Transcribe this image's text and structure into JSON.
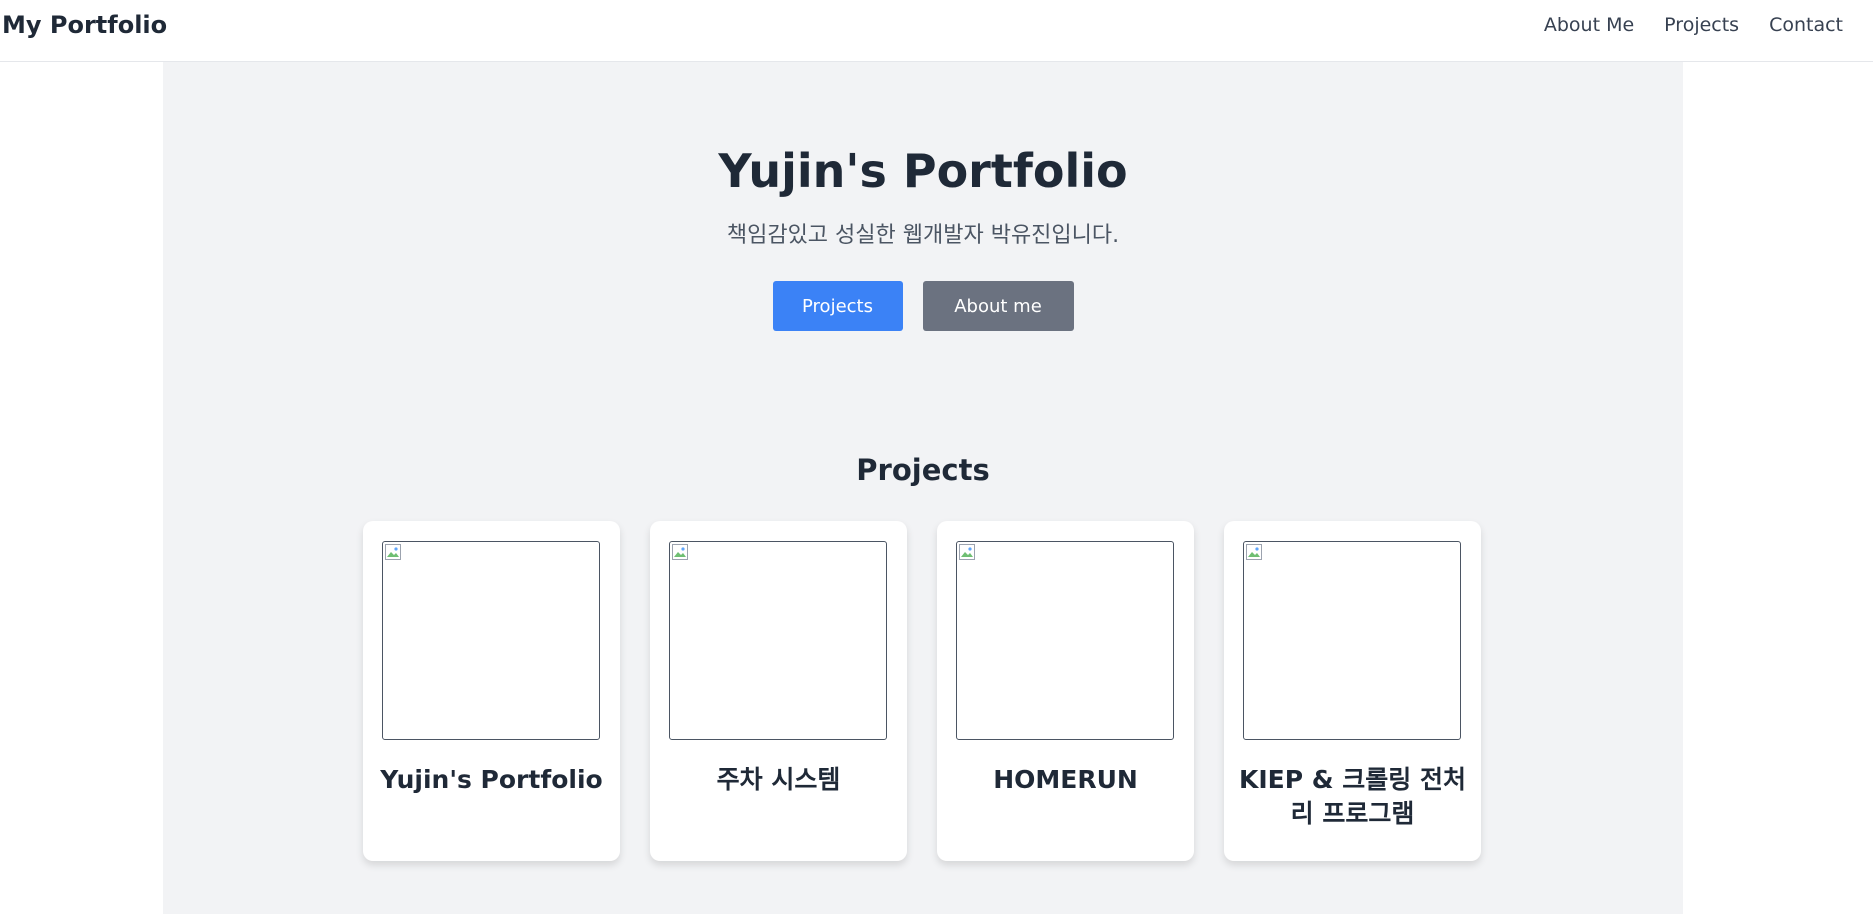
{
  "navbar": {
    "brand": "My Portfolio",
    "links": [
      "About Me",
      "Projects",
      "Contact"
    ]
  },
  "hero": {
    "title": "Yujin's Portfolio",
    "subtitle": "책임감있고 성실한 웹개발자 박유진입니다.",
    "primary_button": "Projects",
    "secondary_button": "About me"
  },
  "projects": {
    "title": "Projects",
    "items": [
      {
        "title": "Yujin's Portfolio",
        "image_icon": "broken-image-icon"
      },
      {
        "title": "주차 시스템",
        "image_icon": "broken-image-icon"
      },
      {
        "title": "HOMERUN",
        "image_icon": "broken-image-icon"
      },
      {
        "title": "KIEP & 크롤링 전처리 프로그램",
        "image_icon": "broken-image-icon"
      }
    ]
  },
  "colors": {
    "primary": "#3b82f6",
    "secondary": "#6b7280",
    "section_bg": "#f2f3f5",
    "text": "#1f2937"
  }
}
